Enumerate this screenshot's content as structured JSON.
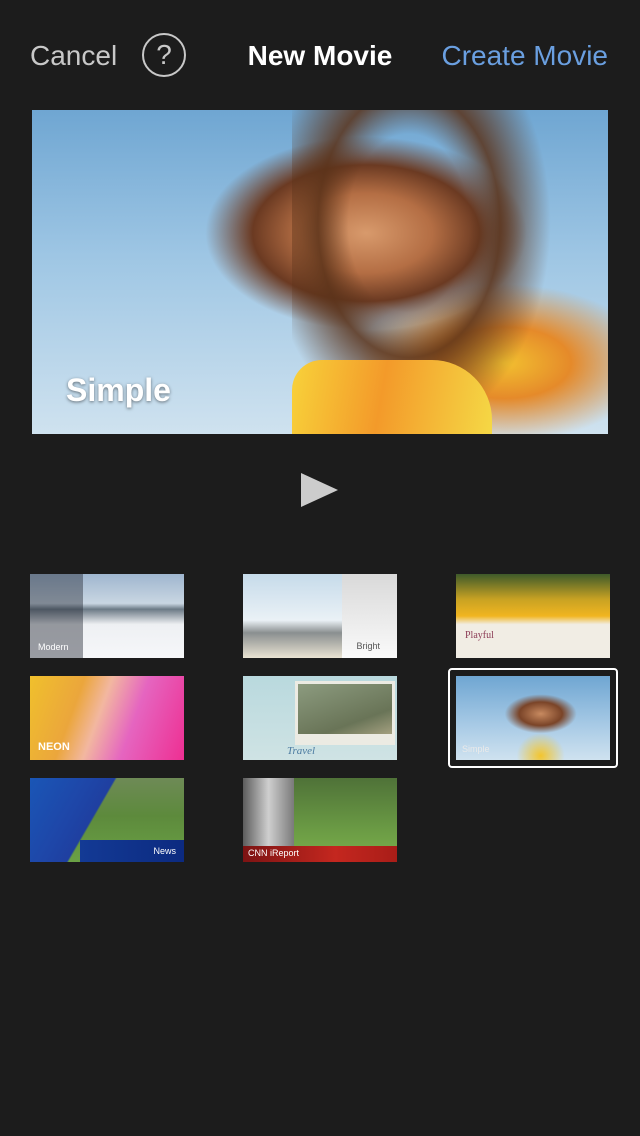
{
  "nav": {
    "cancel_label": "Cancel",
    "help_label": "?",
    "title": "New Movie",
    "create_label": "Create Movie",
    "create_color": "#6a9fe0"
  },
  "preview": {
    "theme_label": "Simple",
    "play_icon": "play-icon"
  },
  "themes": [
    {
      "label": "Modern",
      "selected": false
    },
    {
      "label": "Bright",
      "selected": false
    },
    {
      "label": "Playful",
      "selected": false
    },
    {
      "label": "NEON",
      "selected": false
    },
    {
      "label": "Travel",
      "selected": false
    },
    {
      "label": "Simple",
      "selected": true
    },
    {
      "label": "News",
      "selected": false
    },
    {
      "label": "CNN iReport",
      "selected": false
    }
  ]
}
